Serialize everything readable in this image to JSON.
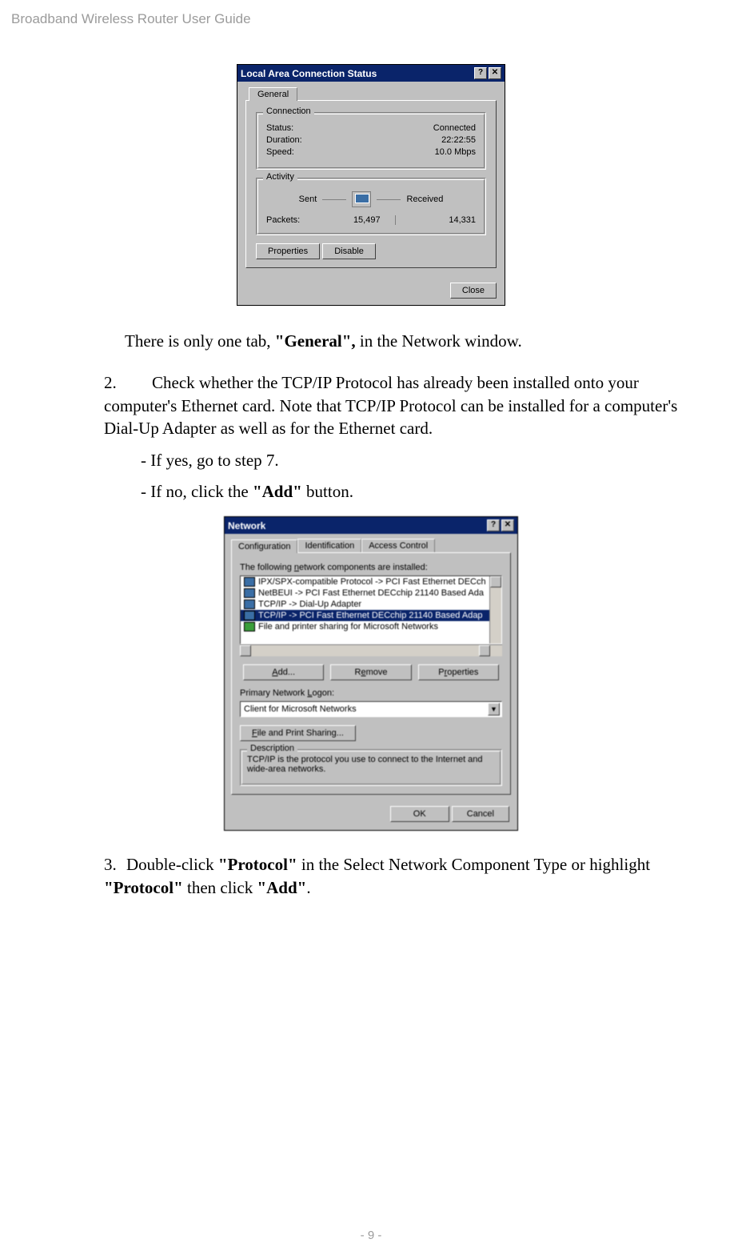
{
  "header": "Broadband Wireless Router User Guide",
  "footer": "- 9 -",
  "dlg1": {
    "title": "Local Area Connection Status",
    "help": "?",
    "close": "✕",
    "tab": "General",
    "group_connection": "Connection",
    "status_lbl": "Status:",
    "status_val": "Connected",
    "duration_lbl": "Duration:",
    "duration_val": "22:22:55",
    "speed_lbl": "Speed:",
    "speed_val": "10.0 Mbps",
    "group_activity": "Activity",
    "sent": "Sent",
    "received": "Received",
    "packets_lbl": "Packets:",
    "packets_sent": "15,497",
    "packets_recv": "14,331",
    "btn_properties": "Properties",
    "btn_disable": "Disable",
    "btn_close": "Close"
  },
  "para1_a": "There is only one tab, ",
  "para1_b": "\"General\",",
  "para1_c": " in the Network window.",
  "step2": {
    "num": "2.",
    "text": "Check whether the TCP/IP Protocol has already been installed onto your computer's Ethernet card. Note that TCP/IP Protocol can be installed for a computer's Dial-Up Adapter as well as for the Ethernet card."
  },
  "dash1": "-  If yes, go to step 7.",
  "dash2_a": "-  If no, click the ",
  "dash2_b": "\"Add\"",
  "dash2_c": " button.",
  "dlg2": {
    "title": "Network",
    "help": "?",
    "close": "✕",
    "tab1": "Configuration",
    "tab2": "Identification",
    "tab3": "Access Control",
    "lbl_components": "The following network components are installed:",
    "items": [
      "IPX/SPX-compatible Protocol -> PCI Fast Ethernet DECch",
      "NetBEUI -> PCI Fast Ethernet DECchip 21140 Based Ada",
      "TCP/IP -> Dial-Up Adapter",
      "TCP/IP -> PCI Fast Ethernet DECchip 21140 Based Adap",
      "File and printer sharing for Microsoft Networks"
    ],
    "btn_add": "Add...",
    "btn_remove": "Remove",
    "btn_properties": "Properties",
    "lbl_logon": "Primary Network Logon:",
    "logon_val": "Client for Microsoft Networks",
    "btn_fps": "File and Print Sharing...",
    "group_desc": "Description",
    "desc_text": "TCP/IP is the protocol you use to connect to the Internet and wide-area networks.",
    "btn_ok": "OK",
    "btn_cancel": "Cancel"
  },
  "step3": {
    "num": "3.",
    "a": "Double-click ",
    "b": "\"Protocol\"",
    "c": " in the Select Network Component Type or highlight ",
    "d": "\"Protocol\"",
    "e": " then click ",
    "f": "\"Add\"",
    "g": "."
  }
}
